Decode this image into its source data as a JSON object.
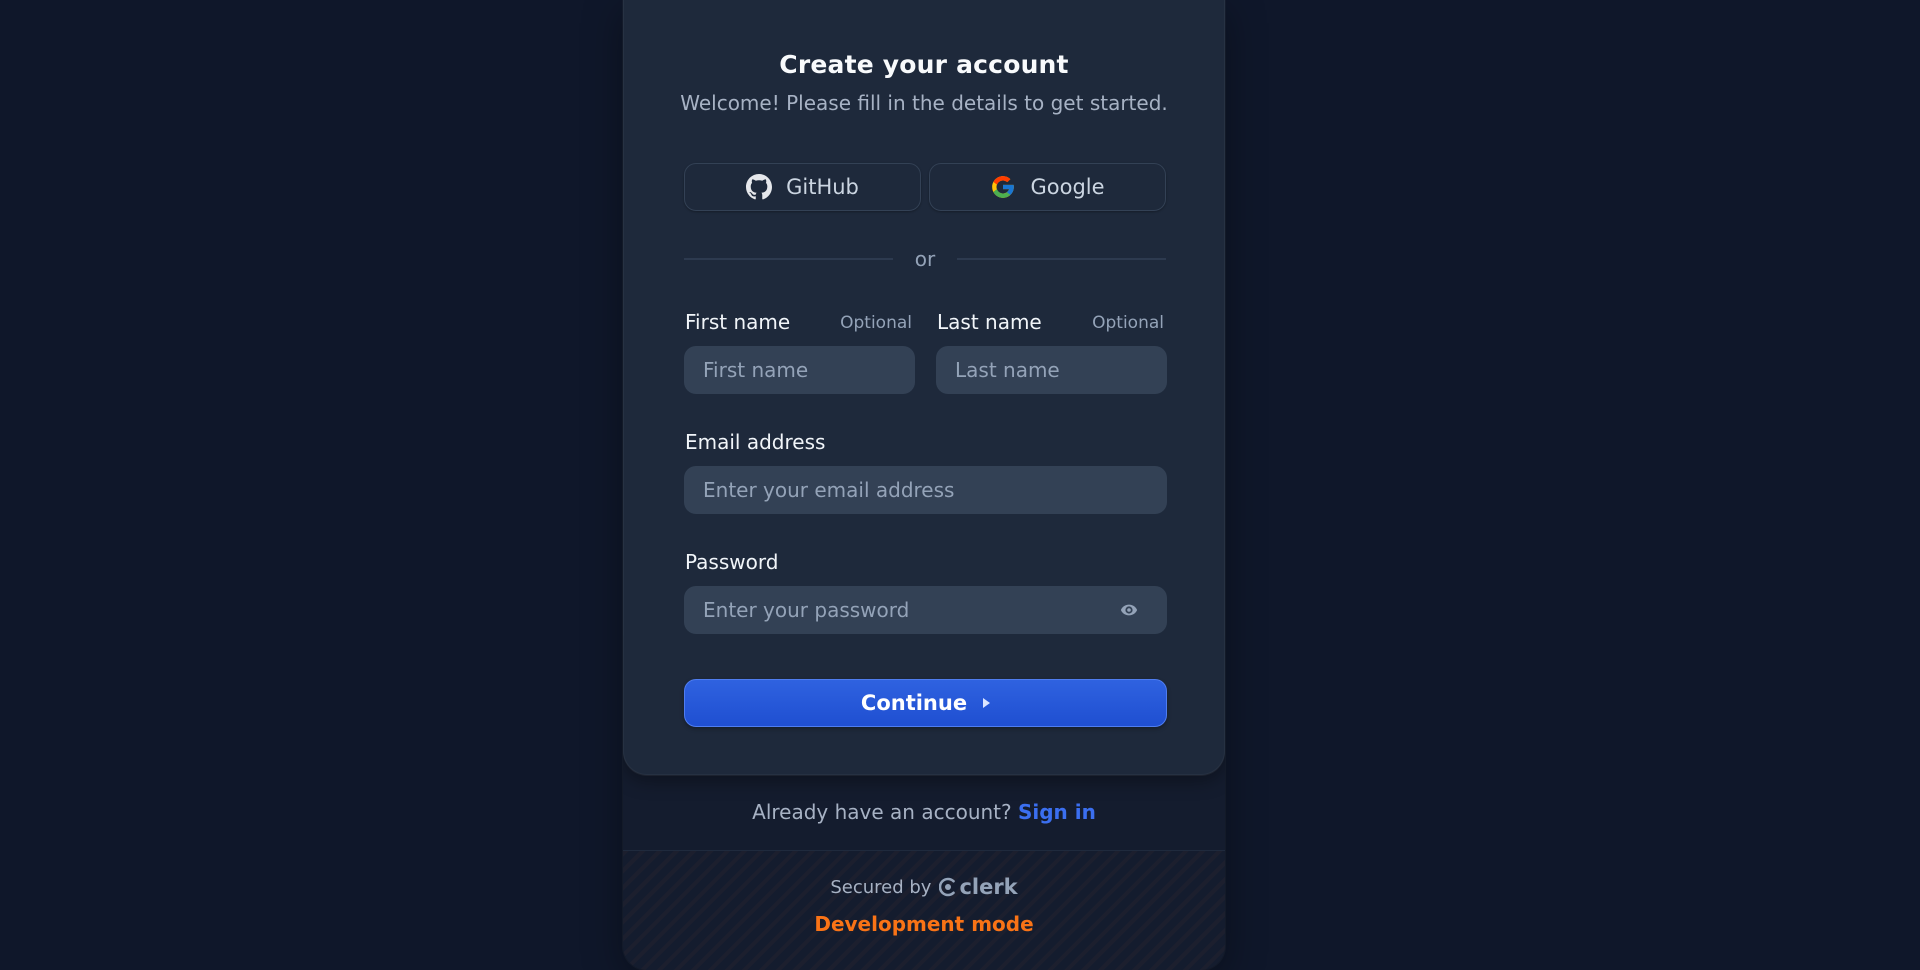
{
  "card": {
    "title": "Create your account",
    "subtitle": "Welcome! Please fill in the details to get started."
  },
  "social": {
    "github_label": "GitHub",
    "google_label": "Google"
  },
  "divider": {
    "text": "or"
  },
  "form": {
    "first_name": {
      "label": "First name",
      "optional": "Optional",
      "placeholder": "First name"
    },
    "last_name": {
      "label": "Last name",
      "optional": "Optional",
      "placeholder": "Last name"
    },
    "email": {
      "label": "Email address",
      "placeholder": "Enter your email address"
    },
    "password": {
      "label": "Password",
      "placeholder": "Enter your password"
    },
    "continue_label": "Continue"
  },
  "footer": {
    "prompt": "Already have an account?",
    "signin_link": "Sign in",
    "secured_by": "Secured by",
    "brand": "clerk",
    "dev_mode": "Development mode"
  },
  "colors": {
    "background": "#0f172a",
    "card": "#1e293b",
    "input": "#334155",
    "primary": "#2563eb",
    "link": "#3b6ff0",
    "dev_mode": "#f97316"
  }
}
